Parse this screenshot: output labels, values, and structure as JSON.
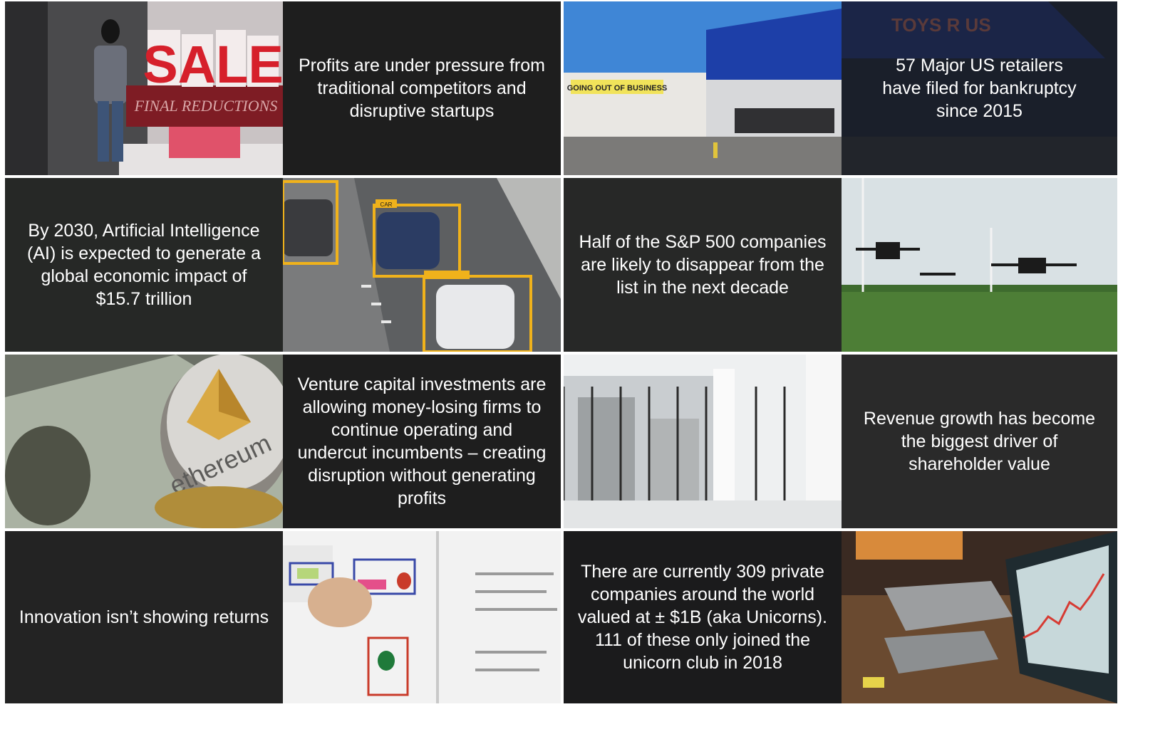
{
  "tiles": [
    {
      "caption": "Profits are under pressure from traditional competitors and disruptive startups",
      "image": {
        "sale_sign": "SALE",
        "banner": "FINAL REDUCTIONS"
      }
    },
    {
      "caption": "57 Major US retailers have filed for bankruptcy since 2015",
      "image": {
        "store_sign": "GOING OUT OF BUSINESS",
        "brand": "TOYS R US"
      }
    },
    {
      "caption": "By 2030, Artificial Intelligence (AI) is expected to generate a global economic impact of $15.7 trillion",
      "image": {
        "detection_label": "CAR"
      }
    },
    {
      "caption": "Half of the S&P 500 companies are likely to disappear from the list in the next decade"
    },
    {
      "caption": "Venture capital investments are allowing money-losing firms to continue operating and undercut incumbents – creating disruption without generating profits",
      "image": {
        "coin_text": "ethereum"
      }
    },
    {
      "caption": "Revenue growth has become the biggest driver of shareholder value"
    },
    {
      "caption": "Innovation isn’t showing returns"
    },
    {
      "caption": "There are currently 309 private companies around the world valued at ± $1B (aka Unicorns). 111 of these only joined the unicorn club in 2018"
    }
  ]
}
